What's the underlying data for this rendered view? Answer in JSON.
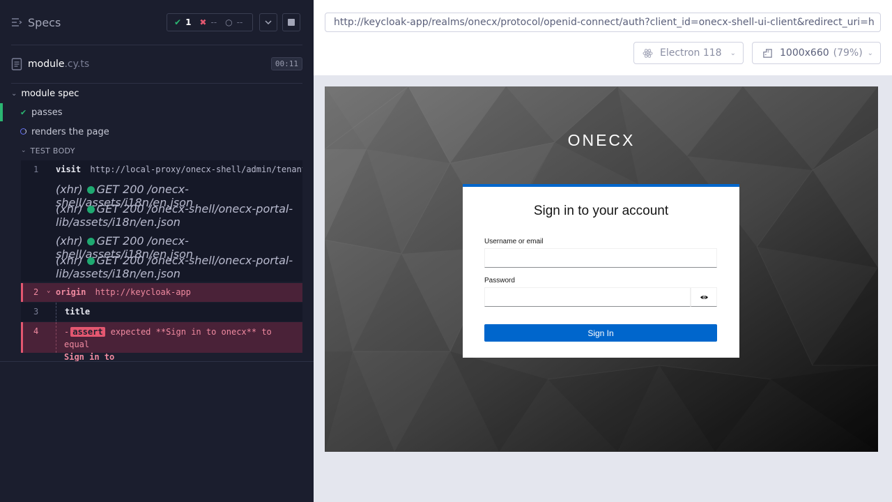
{
  "reporter": {
    "specs_label": "Specs",
    "stats": {
      "passed": "1",
      "failed": "--",
      "pending": "--"
    },
    "spec_file": {
      "name": "module",
      "ext": ".cy.ts",
      "duration": "00:11"
    },
    "suite_title": "module spec",
    "tests": [
      {
        "label": "passes",
        "state": "passed"
      },
      {
        "label": "renders the page",
        "state": "running"
      }
    ],
    "test_body_label": "TEST BODY",
    "commands": {
      "visit": {
        "num": "1",
        "name": "visit",
        "message": "http://local-proxy/onecx-shell/admin/tenant"
      },
      "xhr": [
        {
          "prefix": "(xhr)",
          "text_line1": "GET 200 /onecx-shell/assets/i18n/en.json",
          "text_line2": ""
        },
        {
          "prefix": "(xhr)",
          "text_line1": "GET 200 /onecx-shell/onecx-portal-",
          "text_line2": "lib/assets/i18n/en.json"
        },
        {
          "prefix": "(xhr)",
          "text_line1": "GET 200 /onecx-shell/assets/i18n/en.json",
          "text_line2": ""
        },
        {
          "prefix": "(xhr)",
          "text_line1": "GET 200 /onecx-shell/onecx-portal-",
          "text_line2": "lib/assets/i18n/en.json"
        }
      ],
      "origin": {
        "num": "2",
        "name": "origin",
        "message": "http://keycloak-app"
      },
      "title": {
        "num": "3",
        "name": "title"
      },
      "assert": {
        "num": "4",
        "dash": "-",
        "badge": "assert",
        "message_line1": "expected **Sign in to onecx** to equal",
        "message_line2": "Sign in to"
      }
    },
    "colors": {
      "pass": "#2bb672",
      "fail": "#e45770",
      "running": "#6470f3"
    }
  },
  "aut": {
    "url": "http://keycloak-app/realms/onecx/protocol/openid-connect/auth?client_id=onecx-shell-ui-client&redirect_uri=h",
    "browser": "Electron 118",
    "viewport": "1000x660",
    "scale": "(79%)"
  },
  "login": {
    "brand": "ONECX",
    "title": "Sign in to your account",
    "username_label": "Username or email",
    "password_label": "Password",
    "submit_label": "Sign In",
    "accent_color": "#0066cc"
  }
}
